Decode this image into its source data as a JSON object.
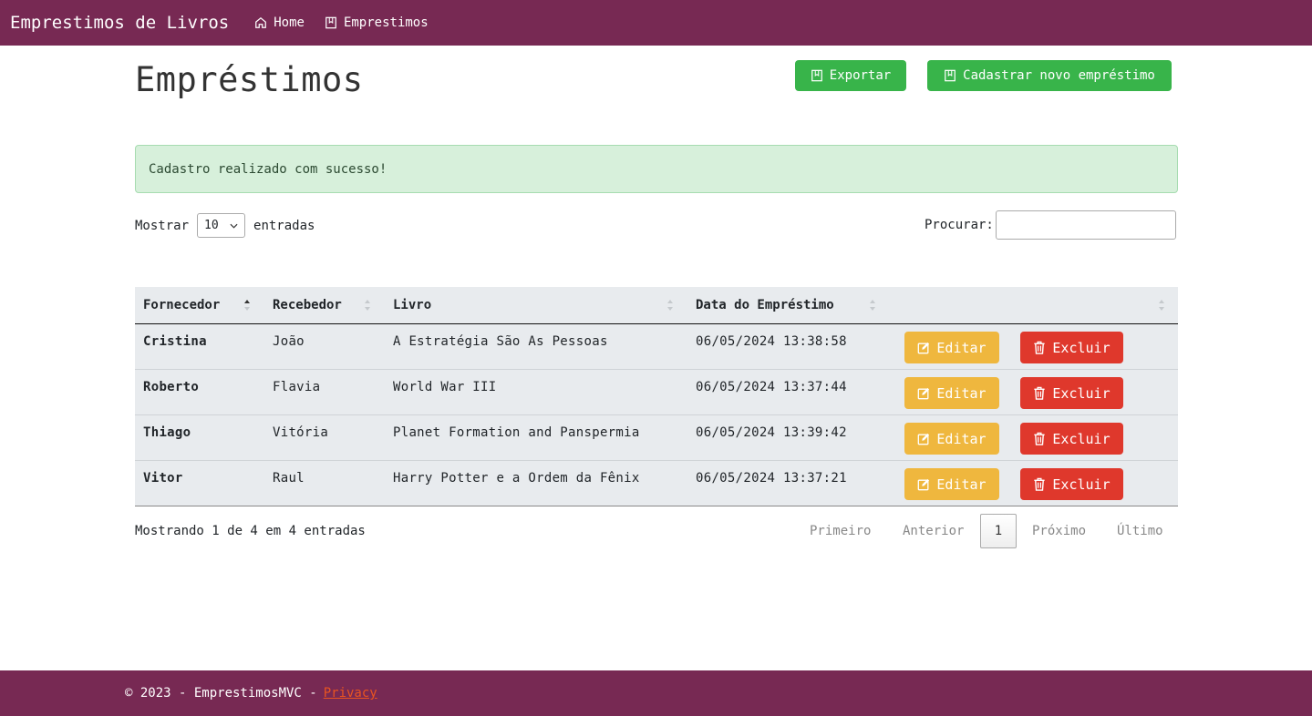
{
  "navbar": {
    "brand": "Emprestimos de Livros",
    "links": [
      {
        "label": "Home",
        "icon": "home-icon"
      },
      {
        "label": "Emprestimos",
        "icon": "bookmark-icon"
      }
    ]
  },
  "page": {
    "title": "Empréstimos",
    "export_label": "Exportar",
    "new_label": "Cadastrar novo empréstimo"
  },
  "alert": {
    "message": "Cadastro realizado com sucesso!"
  },
  "table_controls": {
    "show_label": "Mostrar",
    "page_size": "10",
    "entries_label": "entradas",
    "search_label": "Procurar:"
  },
  "table": {
    "columns": [
      "Fornecedor",
      "Recebedor",
      "Livro",
      "Data do Empréstimo"
    ],
    "rows": [
      {
        "fornecedor": "Cristina",
        "recebedor": "João",
        "livro": "A Estratégia São As Pessoas",
        "data": "06/05/2024 13:38:58"
      },
      {
        "fornecedor": "Roberto",
        "recebedor": "Flavia",
        "livro": "World War III",
        "data": "06/05/2024 13:37:44"
      },
      {
        "fornecedor": "Thiago",
        "recebedor": "Vitória",
        "livro": "Planet Formation and Panspermia",
        "data": "06/05/2024 13:39:42"
      },
      {
        "fornecedor": "Vitor",
        "recebedor": "Raul",
        "livro": "Harry Potter e a Ordem da Fênix",
        "data": "06/05/2024 13:37:21"
      }
    ],
    "edit_label": "Editar",
    "delete_label": "Excluir"
  },
  "pagination": {
    "info": "Mostrando 1 de 4 em 4 entradas",
    "first": "Primeiro",
    "previous": "Anterior",
    "current": "1",
    "next": "Próximo",
    "last": "Último"
  },
  "footer": {
    "copyright": "© 2023 - EmprestimosMVC -",
    "privacy": "Privacy"
  },
  "colors": {
    "navbar": "#772953",
    "success": "#38b44a",
    "warning": "#efb73e",
    "danger": "#df382c",
    "alert_bg": "#d7f0db"
  }
}
